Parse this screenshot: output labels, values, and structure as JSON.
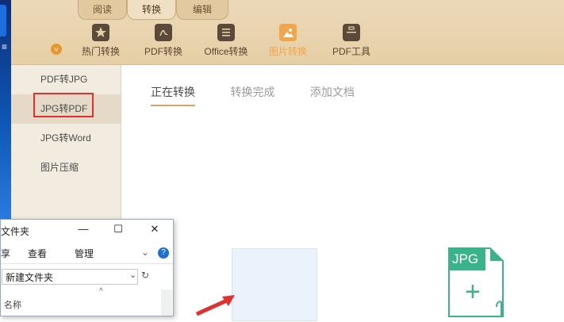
{
  "window": {
    "title": "新建文件夹"
  },
  "top_tabs": [
    {
      "label": "阅读"
    },
    {
      "label": "转换"
    },
    {
      "label": "编辑"
    }
  ],
  "toolbar": {
    "items": [
      {
        "label": "热门转换",
        "icon": "star-document-icon"
      },
      {
        "label": "PDF转换",
        "icon": "pdf-document-icon"
      },
      {
        "label": "Office转换",
        "icon": "office-document-icon"
      },
      {
        "label": "图片转换",
        "icon": "image-document-icon"
      },
      {
        "label": "PDF工具",
        "icon": "toolbox-icon"
      }
    ],
    "clock_glyph": "v"
  },
  "sidebar": {
    "items": [
      {
        "label": "PDF转JPG"
      },
      {
        "label": "JPG转PDF"
      },
      {
        "label": "JPG转Word"
      },
      {
        "label": "图片压缩"
      }
    ]
  },
  "main": {
    "tabs": [
      {
        "label": "正在转换"
      },
      {
        "label": "转换完成"
      },
      {
        "label": "添加文档"
      }
    ],
    "file_badge": "JPG",
    "plus": "+"
  },
  "explorer": {
    "title": "文件夹",
    "menu": [
      "享",
      "查看",
      "管理"
    ],
    "path": "新建文件夹",
    "column_header": "名称",
    "help": "?"
  },
  "colors": {
    "accent_orange": "#f0a64a",
    "topbar_beige": "#ecd9b8",
    "highlight_red": "#e03030",
    "jpg_green": "#3bb38a"
  }
}
